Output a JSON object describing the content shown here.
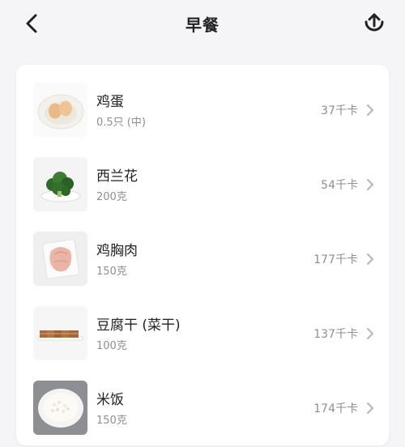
{
  "header": {
    "title": "早餐",
    "back_icon": "chevron-left-icon",
    "share_icon": "upload-share-icon"
  },
  "foods": [
    {
      "name": "鸡蛋",
      "amount": "0.5只 (中)",
      "calories": "37千卡",
      "image": "eggs-on-plate"
    },
    {
      "name": "西兰花",
      "amount": "200克",
      "calories": "54千卡",
      "image": "broccoli-on-plate"
    },
    {
      "name": "鸡胸肉",
      "amount": "150克",
      "calories": "177千卡",
      "image": "chicken-breast"
    },
    {
      "name": "豆腐干 (菜干)",
      "amount": "100克",
      "calories": "137千卡",
      "image": "dried-tofu-slices"
    },
    {
      "name": "米饭",
      "amount": "150克",
      "calories": "174千卡",
      "image": "rice-bowl"
    }
  ],
  "colors": {
    "background": "#f5f5f7",
    "card": "#ffffff",
    "primary_text": "#222222",
    "secondary_text": "#8e8e93"
  }
}
